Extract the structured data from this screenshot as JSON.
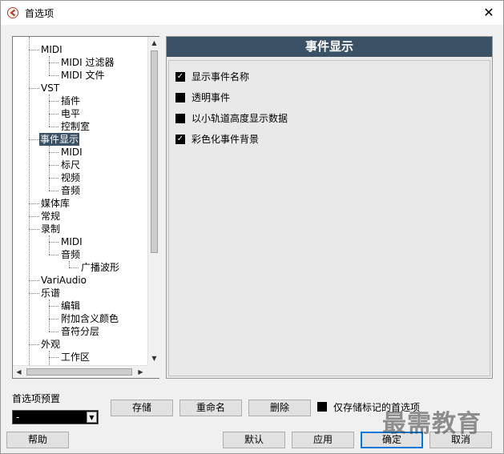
{
  "window": {
    "title": "首选项",
    "close_glyph": "✕"
  },
  "tree": {
    "items": [
      {
        "label": "MIDI"
      },
      {
        "label": "MIDI 过滤器"
      },
      {
        "label": "MIDI 文件"
      },
      {
        "label": "VST"
      },
      {
        "label": "插件"
      },
      {
        "label": "电平"
      },
      {
        "label": "控制室"
      },
      {
        "label": "事件显示",
        "selected": true
      },
      {
        "label": "MIDI"
      },
      {
        "label": "标尺"
      },
      {
        "label": "视频"
      },
      {
        "label": "音频"
      },
      {
        "label": "媒体库"
      },
      {
        "label": "常规"
      },
      {
        "label": "录制"
      },
      {
        "label": "MIDI"
      },
      {
        "label": "音频"
      },
      {
        "label": "广播波形"
      },
      {
        "label": "VariAudio"
      },
      {
        "label": "乐谱"
      },
      {
        "label": "编辑"
      },
      {
        "label": "附加含义颜色"
      },
      {
        "label": "音符分层"
      },
      {
        "label": "外观"
      },
      {
        "label": "工作区"
      }
    ]
  },
  "section": {
    "title": "事件显示",
    "options": [
      {
        "label": "显示事件名称",
        "checked": true
      },
      {
        "label": "透明事件",
        "checked": false
      },
      {
        "label": "以小轨道高度显示数据",
        "checked": false
      },
      {
        "label": "彩色化事件背景",
        "checked": true
      }
    ]
  },
  "presets": {
    "label": "首选项预置",
    "selected": "-",
    "store_label": "存储",
    "rename_label": "重命名",
    "delete_label": "删除",
    "store_marked_label": "仅存储标记的首选项"
  },
  "footer": {
    "help_label": "帮助",
    "defaults_label": "默认",
    "apply_label": "应用",
    "ok_label": "确定",
    "cancel_label": "取消"
  },
  "watermark": "最需教育",
  "colors": {
    "accent": "#3b5266",
    "panel_bg": "#e9e9e9",
    "window_bg": "#f0f0f0"
  }
}
